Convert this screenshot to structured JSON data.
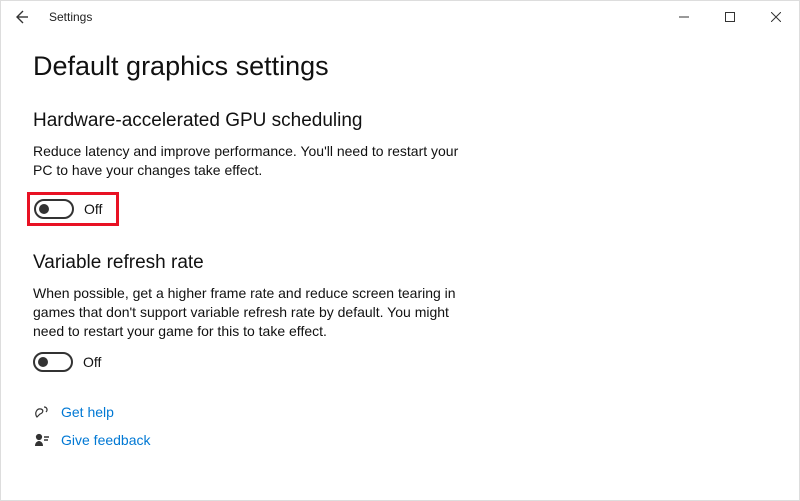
{
  "titlebar": {
    "app_title": "Settings"
  },
  "page": {
    "title": "Default graphics settings"
  },
  "sections": {
    "gpu": {
      "title": "Hardware-accelerated GPU scheduling",
      "desc": "Reduce latency and improve performance. You'll need to restart your PC to have your changes take effect.",
      "toggle_label": "Off",
      "toggle_state": "off"
    },
    "vrr": {
      "title": "Variable refresh rate",
      "desc": "When possible, get a higher frame rate and reduce screen tearing in games that don't support variable refresh rate by default. You might need to restart your game for this to take effect.",
      "toggle_label": "Off",
      "toggle_state": "off"
    }
  },
  "links": {
    "help": "Get help",
    "feedback": "Give feedback"
  },
  "colors": {
    "highlight": "#e81123",
    "link": "#0078d4"
  }
}
